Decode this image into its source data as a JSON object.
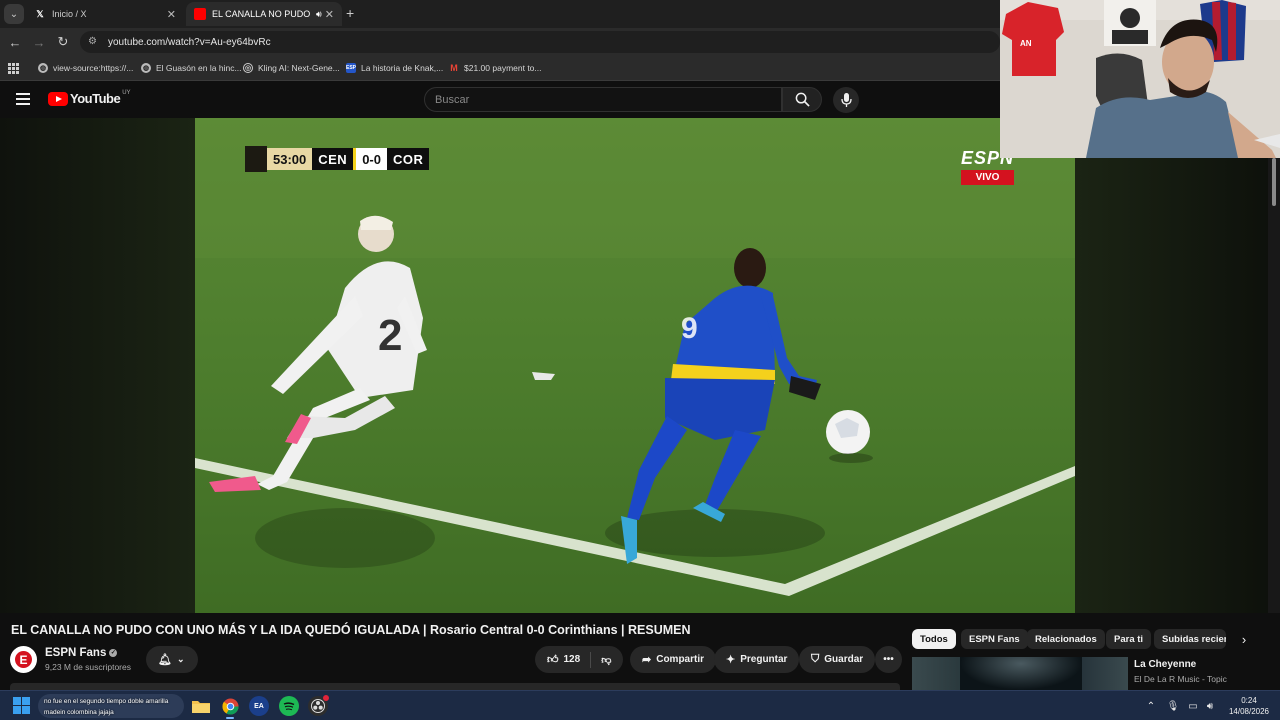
{
  "browser": {
    "tabs": [
      {
        "label": "Inicio / X",
        "favicon": "X"
      },
      {
        "label": "EL CANALLA NO PUDO CON",
        "favicon": "yt"
      }
    ],
    "url": "youtube.com/watch?v=Au-ey64bvRc",
    "bookmarks": [
      {
        "label": "view-source:https://...",
        "icon": "globe-icon"
      },
      {
        "label": "El Guasón en la hinc...",
        "icon": "globe-icon"
      },
      {
        "label": "Kling AI: Next-Gene...",
        "icon": "kling-icon"
      },
      {
        "label": "La historia de Knak,...",
        "icon": "espn-icon"
      },
      {
        "label": "$21.00 payment to...",
        "icon": "gmail-icon"
      }
    ]
  },
  "youtube": {
    "logo_text": "YouTube",
    "country_code": "UY",
    "search_placeholder": "Buscar"
  },
  "video": {
    "scorebug": {
      "time": "53:00",
      "home": "CEN",
      "score": "0-0",
      "away": "COR"
    },
    "broadcaster": "ESPN",
    "live_label": "VIVO",
    "title": "EL CANALLA NO PUDO CON UNO MÁS Y LA IDA QUEDÓ IGUALADA | Rosario Central 0-0 Corinthians | RESUMEN",
    "channel": {
      "name": "ESPN Fans",
      "subscribers": "9,23 M de suscriptores"
    },
    "likes": "128",
    "actions": {
      "share": "Compartir",
      "ask": "Preguntar",
      "save": "Guardar"
    }
  },
  "chips": [
    "Todos",
    "ESPN Fans",
    "Relacionados",
    "Para ti",
    "Subidas recientes"
  ],
  "recommendation": {
    "title": "La Cheyenne",
    "subtitle": "El De La R Music - Topic"
  },
  "chat": {
    "line1": "no fue en el segundo tiempo doble amarilla",
    "line2": "madein colombina jajaja"
  },
  "taskbar": {
    "time": "0:24",
    "date": "14/08/2026"
  },
  "colors": {
    "youtube_red": "#ff0000",
    "espn_red": "#d4121f",
    "pitch_green": "#4a7a2c",
    "taskbar": "#1c2a44"
  }
}
